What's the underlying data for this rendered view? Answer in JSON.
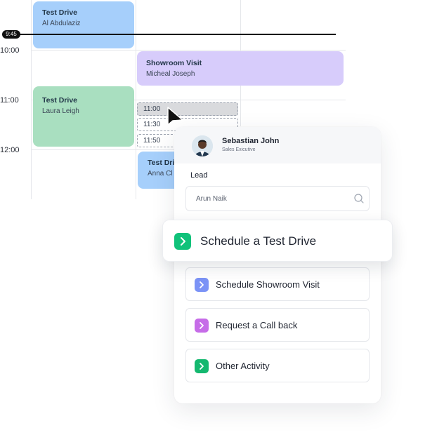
{
  "calendar": {
    "current_time": "9:45",
    "times": [
      "10:00",
      "11:00",
      "12:00"
    ],
    "events": [
      {
        "title": "Test Drive",
        "name": "Al Abdulaziz",
        "color": "#a6cffb"
      },
      {
        "title": "Showroom Visit",
        "name": "Micheal Joseph",
        "color": "#d7ccfb"
      },
      {
        "title": "Test Drive",
        "name": "Laura Leigh",
        "color": "#a9dfc0"
      },
      {
        "title": "Test Drive",
        "name": "Anna Cl",
        "color": "#a6cffb"
      }
    ],
    "slots": [
      "11:00",
      "11:30",
      "11:50"
    ]
  },
  "panel": {
    "user_name": "Sebastian John",
    "user_role": "Sales Exicutive",
    "lead_label": "Lead",
    "lead_value": "Arun Naik",
    "search_icon": "search-icon",
    "options": [
      {
        "label": "Schedule a Test Drive",
        "color": "#10c27a"
      },
      {
        "label": "Schedule Showroom Visit",
        "color": "#7b93f6"
      },
      {
        "label": "Request a Call back",
        "color": "#c66ce8"
      },
      {
        "label": "Other Activity",
        "color": "#14b86f"
      }
    ]
  }
}
